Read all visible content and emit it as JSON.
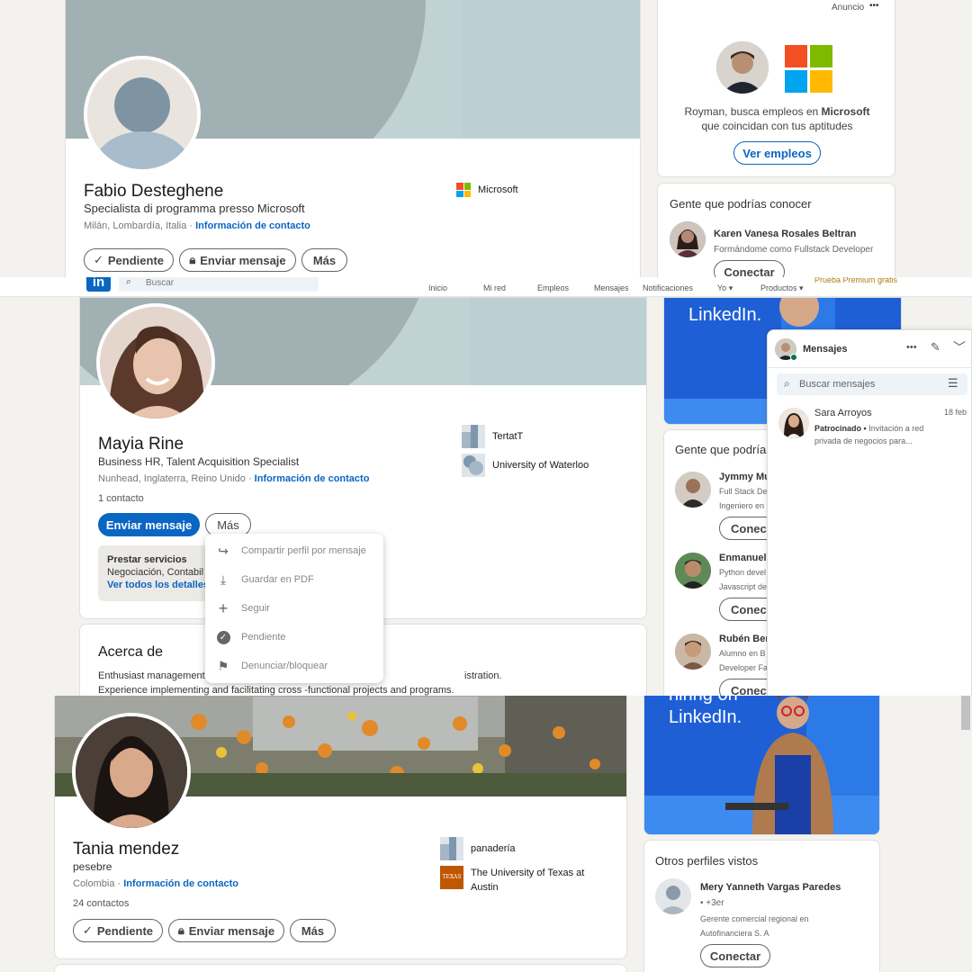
{
  "colors": {
    "accent": "#0a66c2",
    "cover": "#a7b8bd",
    "banner_blue": "#1f5fd6",
    "premium": "#b17b12"
  },
  "panel1": {
    "profile": {
      "name": "Fabio Desteghene",
      "headline": "Specialista di programma presso Microsoft",
      "location": "Milán, Lombardía, Italia ·",
      "contact_link": "Información de contacto",
      "company": "Microsoft",
      "buttons": {
        "pending": "Pendiente",
        "message": "Enviar mensaje",
        "more": "Más"
      }
    },
    "ad": {
      "label": "Anuncio",
      "more": "•••",
      "text_prefix": "Royman, busca empleos en",
      "text_brand": "Microsoft",
      "text_suffix": "que coincidan con tus aptitudes",
      "button": "Ver empleos"
    },
    "people": {
      "title": "Gente que podrías conocer",
      "items": [
        {
          "name": "Karen Vanesa Rosales Beltran",
          "subtitle": "Formándome como Fullstack Developer",
          "button": "Conectar"
        }
      ]
    }
  },
  "panel2": {
    "nav": {
      "search_placeholder": "Buscar",
      "items": [
        "Inicio",
        "Mi red",
        "Empleos",
        "Mensajes",
        "Notificaciones",
        "Yo",
        "Productos"
      ],
      "premium": "Prueba Premium gratis"
    },
    "profile": {
      "name": "Mayia Rine",
      "headline": "Business HR, Talent Acquisition Specialist",
      "location": "Nunhead, Inglaterra, Reino Unido ·",
      "contact_link": "Información de contacto",
      "connections": "1 contacto",
      "orgs": [
        "TertatT",
        "University of Waterloo"
      ],
      "buttons": {
        "message": "Enviar mensaje",
        "more": "Más"
      },
      "services": {
        "title": "Prestar servicios",
        "text": "Negociación, Contabil",
        "link": "Ver todos los detalles"
      }
    },
    "menu": [
      {
        "icon": "share-icon",
        "label": "Compartir perfil por mensaje"
      },
      {
        "icon": "download-icon",
        "label": "Guardar en PDF"
      },
      {
        "icon": "plus-icon",
        "label": "Seguir"
      },
      {
        "icon": "check-circle-icon",
        "label": "Pendiente"
      },
      {
        "icon": "flag-icon",
        "label": "Denunciar/bloquear"
      }
    ],
    "about": {
      "title": "Acerca de",
      "line1_start": "Enthusiast management",
      "line1_end": "istration.",
      "line2": "Experience implementing and facilitating cross -functional projects and programs."
    },
    "banner": {
      "text": "LinkedIn."
    },
    "people": {
      "title": "Gente que podrías",
      "items": [
        {
          "name": "Jymmy Mu",
          "line1": "Full Stack De",
          "line2": "Ingeniero en",
          "button": "Conecta"
        },
        {
          "name": "Enmanuel",
          "line1": "Python devel",
          "line2": "Javascript de",
          "button": "Conecta"
        },
        {
          "name": "Rubén Bert",
          "line1": "Alumno en B",
          "line2": "Developer Fa",
          "button": "Conecta"
        }
      ]
    },
    "messages": {
      "title": "Mensajes",
      "search_placeholder": "Buscar mensajes",
      "conversations": [
        {
          "name": "Sara Arroyos",
          "date": "18 feb",
          "tag": "Patrocinado •",
          "preview1": "Invitación a red",
          "preview2": "privada de negocios para..."
        }
      ]
    }
  },
  "panel3": {
    "profile": {
      "name": "Tania mendez",
      "headline": "pesebre",
      "location": "Colombia ·",
      "contact_link": "Información de contacto",
      "connections": "24 contactos",
      "orgs": [
        "panadería",
        "The University of Texas at",
        "Austin"
      ],
      "texas_logo": "TEXAS",
      "buttons": {
        "pending": "Pendiente",
        "message": "Enviar mensaje",
        "more": "Más"
      }
    },
    "banner": {
      "line1": "hiring on",
      "line2": "LinkedIn."
    },
    "others": {
      "title": "Otros perfiles vistos",
      "items": [
        {
          "name": "Mery Yanneth Vargas Paredes",
          "degree": "• +3er",
          "subtitle1": "Gerente comercial regional en",
          "subtitle2": "Autofinanciera S. A",
          "button": "Conectar"
        }
      ]
    }
  }
}
